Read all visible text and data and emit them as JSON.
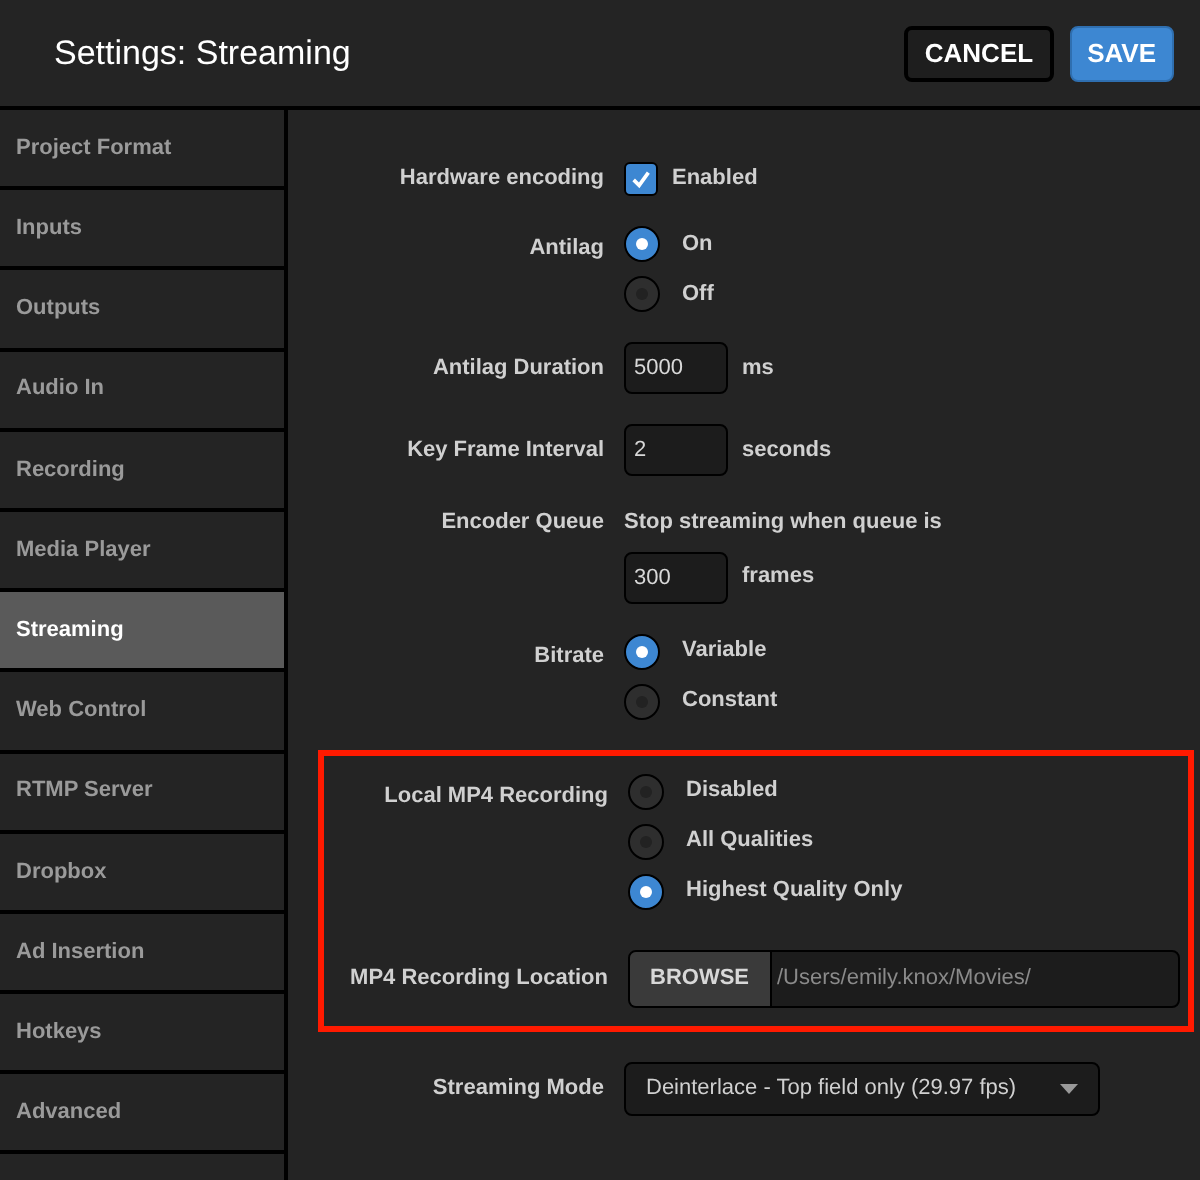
{
  "window": {
    "title": "Settings: Streaming"
  },
  "buttons": [
    {
      "label": "CANCEL",
      "kind": "secondary"
    },
    {
      "label": "SAVE",
      "kind": "primary"
    }
  ],
  "sidebar": {
    "items": [
      {
        "label": "Project Format",
        "selected": false
      },
      {
        "label": "Inputs",
        "selected": false
      },
      {
        "label": "Outputs",
        "selected": false
      },
      {
        "label": "Audio In",
        "selected": false
      },
      {
        "label": "Recording",
        "selected": false
      },
      {
        "label": "Media Player",
        "selected": false
      },
      {
        "label": "Streaming",
        "selected": true
      },
      {
        "label": "Web Control",
        "selected": false
      },
      {
        "label": "RTMP Server",
        "selected": false
      },
      {
        "label": "Dropbox",
        "selected": false
      },
      {
        "label": "Ad Insertion",
        "selected": false
      },
      {
        "label": "Hotkeys",
        "selected": false
      },
      {
        "label": "Advanced",
        "selected": false
      }
    ]
  },
  "settings": [
    {
      "kind": "checkbox",
      "label": "Hardware encoding",
      "option": "Enabled",
      "checked": true,
      "highlighted": false
    },
    {
      "kind": "radio",
      "label": "Antilag",
      "options": [
        {
          "label": "On",
          "selected": true
        },
        {
          "label": "Off",
          "selected": false
        }
      ],
      "highlighted": false
    },
    {
      "kind": "number",
      "label": "Antilag Duration",
      "value": "5000",
      "unit": "ms",
      "highlighted": false
    },
    {
      "kind": "number",
      "label": "Key Frame Interval",
      "value": "2",
      "unit": "seconds",
      "highlighted": false
    },
    {
      "kind": "queue",
      "label": "Encoder Queue",
      "text": "Stop streaming when queue is",
      "value": "300",
      "unit": "frames",
      "highlighted": false
    },
    {
      "kind": "radio",
      "label": "Bitrate",
      "options": [
        {
          "label": "Variable",
          "selected": true
        },
        {
          "label": "Constant",
          "selected": false
        }
      ],
      "highlighted": false
    },
    {
      "kind": "radio",
      "label": "Local MP4 Recording",
      "options": [
        {
          "label": "Disabled",
          "selected": false
        },
        {
          "label": "All Qualities",
          "selected": false
        },
        {
          "label": "Highest Quality Only",
          "selected": true
        }
      ],
      "highlighted": true
    },
    {
      "kind": "browse",
      "label": "MP4 Recording Location",
      "button": "BROWSE",
      "value": "/Users/emily.knox/Movies/",
      "highlighted": true
    },
    {
      "kind": "select",
      "label": "Streaming Mode",
      "value": "Deinterlace - Top field only (29.97 fps)",
      "highlighted": false
    }
  ]
}
